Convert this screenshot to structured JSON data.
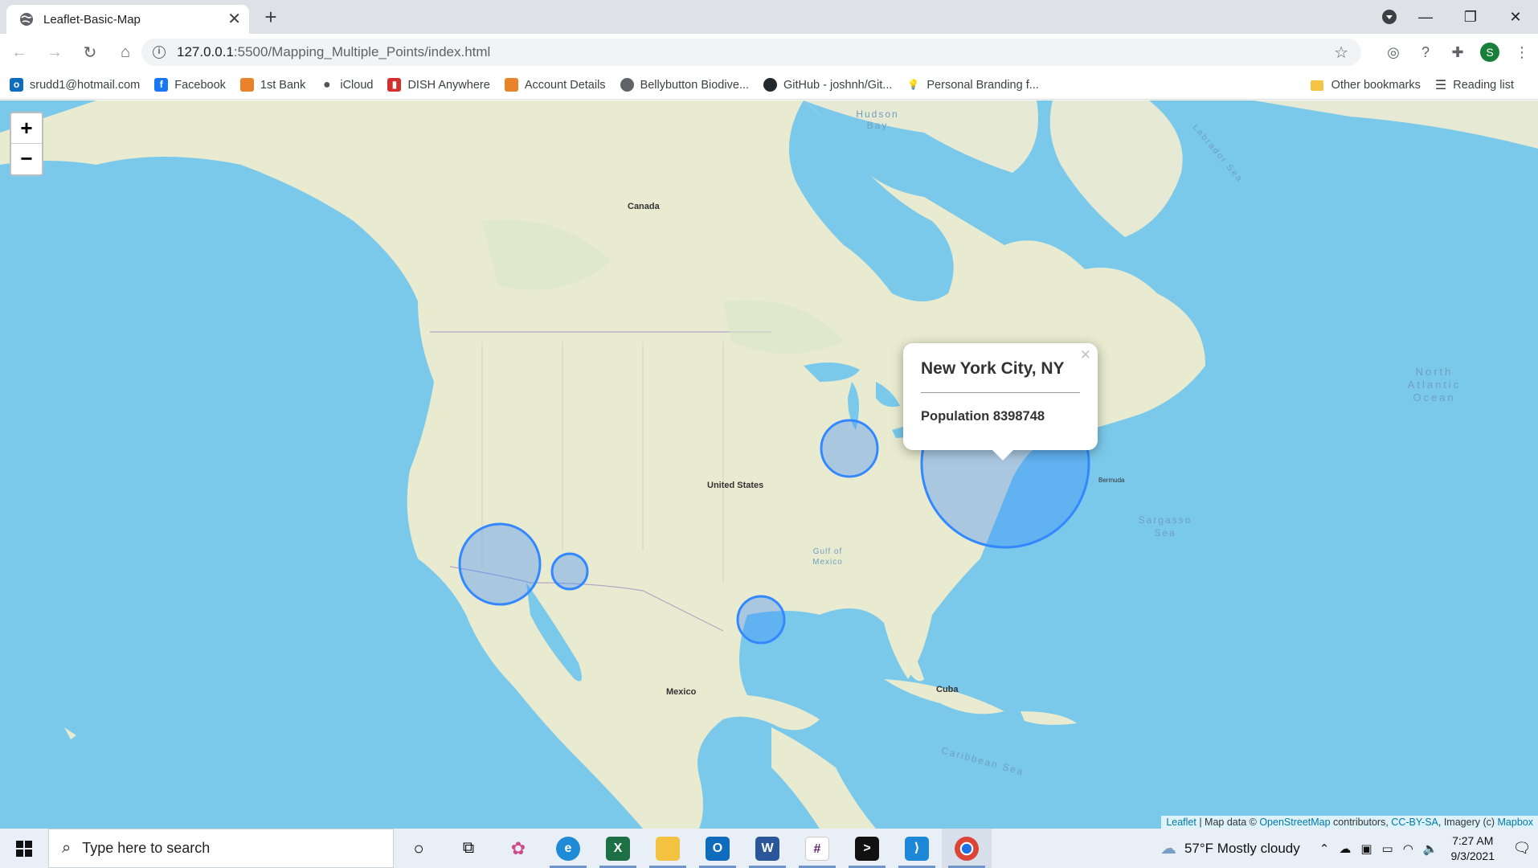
{
  "browser": {
    "tab_title": "Leaflet-Basic-Map",
    "url_host": "127.0.0.1",
    "url_path": ":5500/Mapping_Multiple_Points/index.html",
    "profile_initial": "S",
    "bookmarks": [
      {
        "label": "srudd1@hotmail.com",
        "icon": "outlook-icon",
        "color": "#0f6cbd"
      },
      {
        "label": "Facebook",
        "icon": "facebook-icon",
        "color": "#1877f2"
      },
      {
        "label": "1st Bank",
        "icon": "bookmark-page-icon",
        "color": "#e8832a"
      },
      {
        "label": "iCloud",
        "icon": "apple-icon",
        "color": "#555555"
      },
      {
        "label": "DISH Anywhere",
        "icon": "dish-icon",
        "color": "#d32f2f"
      },
      {
        "label": "Account Details",
        "icon": "bookmark-page-icon",
        "color": "#e8832a"
      },
      {
        "label": "Bellybutton Biodive...",
        "icon": "globe-icon",
        "color": "#5f6368"
      },
      {
        "label": "GitHub - joshnh/Git...",
        "icon": "github-icon",
        "color": "#24292e"
      },
      {
        "label": "Personal Branding f...",
        "icon": "lightbulb-icon",
        "color": "#9aa0a6"
      }
    ],
    "other_bookmarks": "Other bookmarks",
    "reading_list": "Reading list"
  },
  "map": {
    "labels": {
      "canada": "Canada",
      "us": "United States",
      "mexico": "Mexico",
      "cuba": "Cuba",
      "hudson_bay": "Hudson Bay",
      "north_atlantic": "North Atlantic Ocean",
      "sargasso": "Sargasso Sea",
      "caribbean": "Caribbean Sea",
      "gulf": "Gulf of Mexico",
      "labrador": "Labrador Sea",
      "bermuda": "Bermuda"
    },
    "markers": [
      {
        "name": "Los Angeles",
        "highlight": false
      },
      {
        "name": "Phoenix",
        "highlight": false
      },
      {
        "name": "San Antonio",
        "highlight": false
      },
      {
        "name": "Chicago",
        "highlight": false
      },
      {
        "name": "New York City",
        "highlight": true
      }
    ],
    "popup": {
      "title": "New York City, NY",
      "population": "Population 8398748"
    },
    "zoom_in": "+",
    "zoom_out": "−",
    "attribution": {
      "leaflet": "Leaflet",
      "sep1": " | Map data © ",
      "osm": "OpenStreetMap",
      "contrib": " contributors, ",
      "license": "CC-BY-SA",
      "imagery": ", Imagery (c) ",
      "mapbox": "Mapbox"
    }
  },
  "taskbar": {
    "search_placeholder": "Type here to search",
    "weather": "57°F  Mostly cloudy",
    "time": "7:27 AM",
    "date": "9/3/2021"
  }
}
